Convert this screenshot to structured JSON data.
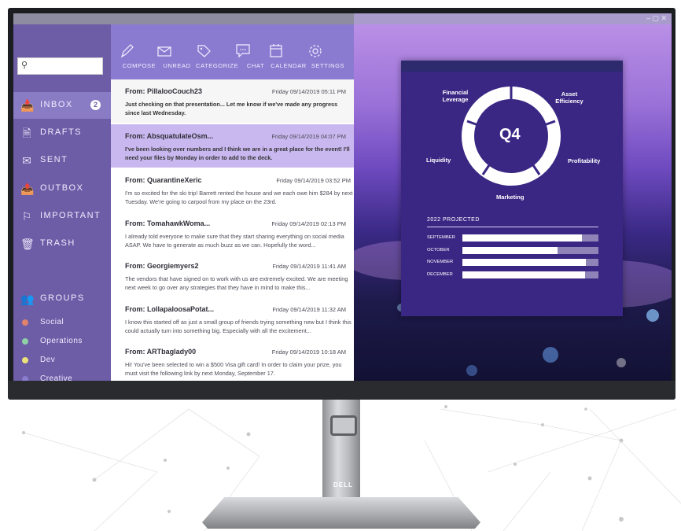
{
  "window": {
    "controls": "– ▢ ✕",
    "controls_right": "– ▢ ✕"
  },
  "brand": "DELL",
  "sidebar": {
    "search_placeholder": "",
    "items": [
      {
        "label": "INBOX",
        "icon": "inbox-icon",
        "badge": "2",
        "active": true
      },
      {
        "label": "DRAFTS",
        "icon": "drafts-icon"
      },
      {
        "label": "SENT",
        "icon": "sent-icon"
      },
      {
        "label": "OUTBOX",
        "icon": "outbox-icon"
      },
      {
        "label": "IMPORTANT",
        "icon": "flag-icon"
      },
      {
        "label": "TRASH",
        "icon": "trash-icon"
      }
    ],
    "groups_label": "GROUPS",
    "groups": [
      {
        "label": "Social",
        "color": "#e0836d"
      },
      {
        "label": "Operations",
        "color": "#8fd0a6"
      },
      {
        "label": "Dev",
        "color": "#ece27a"
      },
      {
        "label": "Creative",
        "color": "#8a7dd0"
      }
    ]
  },
  "toolbar": {
    "compose": "COMPOSE",
    "unread": "UNREAD",
    "categorize": "CATEGORIZE",
    "chat": "CHAT",
    "calendar": "CALENDAR",
    "settings": "SETTINGS"
  },
  "emails": [
    {
      "from": "From: PillalooCouch23",
      "date": "Friday 09/14/2019 05:11 PM",
      "body": "Just checking on that presentation... Let me know if we've made any progress since last Wednesday."
    },
    {
      "from": "From: AbsquatulateOsm...",
      "date": "Friday 09/14/2019 04:07 PM",
      "body": "I've been looking over numbers and I think we are in a great place for the event! I'll need your files by Monday in order to add to the deck."
    },
    {
      "from": "From: QuarantineXeric",
      "date": "Friday 09/14/2019 03:52 PM",
      "body": "I'm so excited for the ski trip! Barrett rented the house and we each owe him $284 by next Tuesday. We're going to carpool from my place on the 23rd."
    },
    {
      "from": "From: TomahawkWoma...",
      "date": "Friday 09/14/2019 02:13 PM",
      "body": "I already told everyone to make sure that they start sharing everything on social media ASAP. We have to generate as much buzz as we can. Hopefully the word..."
    },
    {
      "from": "From: Georgiemyers2",
      "date": "Friday 09/14/2019 11:41 AM",
      "body": "The vendors that have signed on to work with us are extremely excited. We are meeting next week to go over any strategies that they have in mind to make this..."
    },
    {
      "from": "From: LollapaloosaPotat...",
      "date": "Friday 09/14/2019 11:32 AM",
      "body": "I know this started off as just a small group of friends trying something new but I think this could actually turn into something big. Especially with all the excitement..."
    },
    {
      "from": "From: ARTbaglady00",
      "date": "Friday 09/14/2019 10:18 AM",
      "body": "Hi! You've been selected to win a $500 Visa gift card! In order to claim your prize, you must visit the following link by next Monday, September 17."
    }
  ],
  "panel": {
    "center": "Q4",
    "labels": {
      "financial": "Financial Leverage",
      "asset": "Asset Efficiency",
      "liquidity": "Liquidity",
      "profitability": "Profitability",
      "marketing": "Marketing"
    },
    "projected_title": "2022 PROJECTED",
    "bars": [
      {
        "month": "SEPTEMBER",
        "value": 0.88
      },
      {
        "month": "OCTOBER",
        "value": 0.7
      },
      {
        "month": "NOVEMBER",
        "value": 0.91
      },
      {
        "month": "DECEMBER",
        "value": 0.9
      }
    ]
  }
}
